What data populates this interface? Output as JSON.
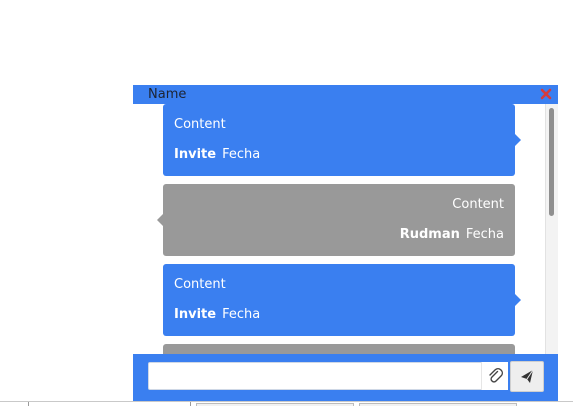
{
  "chat": {
    "title": "Name",
    "accent_color": "#3a7ff0",
    "other_color": "#999999",
    "close_icon": "close-icon",
    "close_color": "#d63b3b"
  },
  "messages": [
    {
      "type": "invite",
      "content": "Content",
      "author": "Invite",
      "date": "Fecha"
    },
    {
      "type": "rudman",
      "content": "Content",
      "author": "Rudman",
      "date": "Fecha"
    },
    {
      "type": "invite",
      "content": "Content",
      "author": "Invite",
      "date": "Fecha"
    },
    {
      "type": "rudman",
      "content": "",
      "author": "",
      "date": ""
    }
  ],
  "composer": {
    "value": "",
    "placeholder": "",
    "attach_icon": "paperclip-icon",
    "send_icon": "send-icon"
  }
}
